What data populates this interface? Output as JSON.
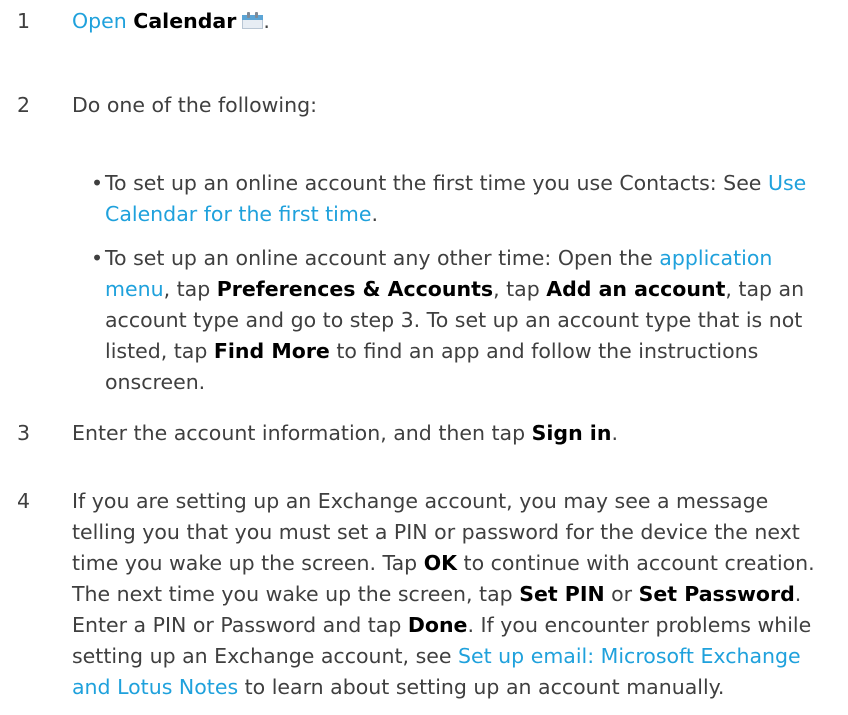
{
  "steps": [
    {
      "number": "1",
      "open_link": "Open",
      "app_name": "Calendar",
      "icon": "calendar-icon",
      "end": "."
    },
    {
      "number": "2",
      "intro": "Do one of the following:",
      "bullet1": {
        "dot": "•",
        "text_before": "To set up an online account the first time you use Contacts: See ",
        "link": "Use Calendar for the first time",
        "text_after": "."
      },
      "bullet2": {
        "dot": "•",
        "t1": "To set up an online account any other time: Open the ",
        "link_menu": "application menu",
        "t2": ", tap ",
        "b1": "Preferences & Accounts",
        "t3": ", tap ",
        "b2": "Add an account",
        "t4": ", tap an account type and go to step 3. To set up an account type that is not listed, tap ",
        "b3": "Find More",
        "t5": " to find an app and follow the instructions onscreen."
      }
    },
    {
      "number": "3",
      "t1": "Enter the account information, and then tap ",
      "b1": "Sign in",
      "t2": "."
    },
    {
      "number": "4",
      "t1": "If you are setting up an Exchange account, you may see a message telling you that you must set a PIN or password for the device the next time you wake up the screen. Tap ",
      "b1": "OK",
      "t2": " to continue with account creation. The next time you wake up the screen, tap ",
      "b2": "Set PIN",
      "t3": " or ",
      "b3": "Set Password",
      "t4": ". Enter a PIN or Password and tap ",
      "b4": "Done",
      "t5": ". If you encounter problems while setting up an Exchange account, see ",
      "link": "Set up email: Microsoft Exchange and Lotus Notes",
      "t6": " to learn about setting up an account manually."
    }
  ]
}
